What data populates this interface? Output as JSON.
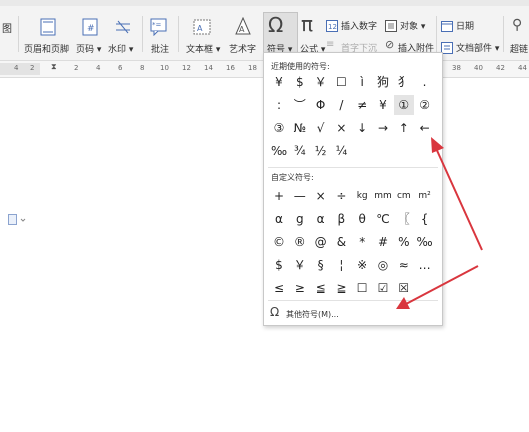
{
  "toolbar": {
    "left_partial": "图",
    "header_footer": "页眉和页脚",
    "page_number": "页码",
    "watermark": "水印",
    "comment": "批注",
    "textbox": "文本框",
    "wordart": "艺术字",
    "symbol": "符号",
    "formula": "公式",
    "insert_number": "插入数字",
    "object": "对象",
    "first_letter_sink": "首字下沉",
    "insert_attachment": "插入附件",
    "date": "日期",
    "doc_parts": "文档部件",
    "hyperlink_partial": "超链"
  },
  "ruler": {
    "numbers": [
      "4",
      "2",
      "2",
      "4",
      "6",
      "8",
      "10",
      "12",
      "14",
      "16",
      "18",
      "38",
      "40",
      "42",
      "44"
    ]
  },
  "symbol_menu": {
    "recent_title": "近期使用的符号:",
    "recent_rows": [
      [
        "¥",
        "$",
        "￥",
        "☐",
        "ì",
        "狗",
        "犭",
        "."
      ],
      [
        ":",
        "︶",
        "Φ",
        "/",
        "≠",
        "¥",
        "①",
        "②"
      ],
      [
        "③",
        "№",
        "√",
        "×",
        "↓",
        "→",
        "↑",
        "←"
      ],
      [
        "‰",
        "¾",
        "½",
        "¼"
      ]
    ],
    "custom_title": "自定义符号:",
    "custom_rows": [
      [
        "+",
        "—",
        "×",
        "÷",
        "kg",
        "mm",
        "cm",
        "m²"
      ],
      [
        "α",
        "g",
        "α",
        "β",
        "θ",
        "℃",
        "〖",
        "{"
      ],
      [
        "©",
        "®",
        "@",
        "&",
        "*",
        "#",
        "%",
        "‰"
      ],
      [
        "$",
        "￥",
        "§",
        "¦",
        "※",
        "◎",
        "≈",
        "…"
      ],
      [
        "≤",
        "≥",
        "≦",
        "≧",
        "☐",
        "☑",
        "☒"
      ]
    ],
    "more_symbols": "其他符号(M)..."
  }
}
